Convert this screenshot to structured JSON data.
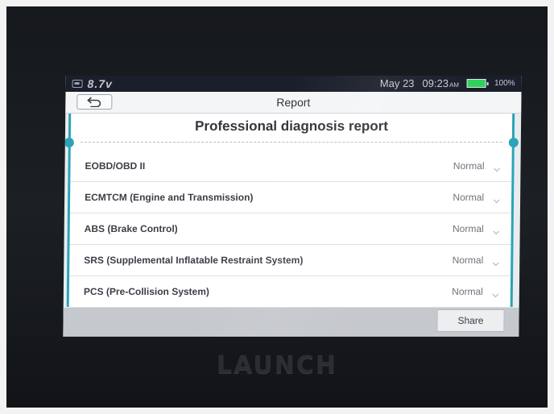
{
  "device": {
    "brand_label": "LAUNCH"
  },
  "status_bar": {
    "voltage": "8.7v",
    "date": "May 23",
    "time": "09:23",
    "ampm": "AM",
    "battery_percent": "100%",
    "battery_level": 1.0
  },
  "title_bar": {
    "title": "Report",
    "back_icon": "back-arrow-icon"
  },
  "report": {
    "heading": "Professional diagnosis report",
    "systems": [
      {
        "name": "EOBD/OBD II",
        "status": "Normal"
      },
      {
        "name": "ECMTCM (Engine and Transmission)",
        "status": "Normal"
      },
      {
        "name": "ABS (Brake Control)",
        "status": "Normal"
      },
      {
        "name": "SRS (Supplemental Inflatable Restraint System)",
        "status": "Normal"
      },
      {
        "name": "PCS (Pre-Collision System)",
        "status": "Normal"
      }
    ]
  },
  "bottom_bar": {
    "share_label": "Share"
  },
  "colors": {
    "accent": "#2aa4b6",
    "status_bar_bg": "#1b1f2b",
    "battery_green": "#30d15a"
  }
}
